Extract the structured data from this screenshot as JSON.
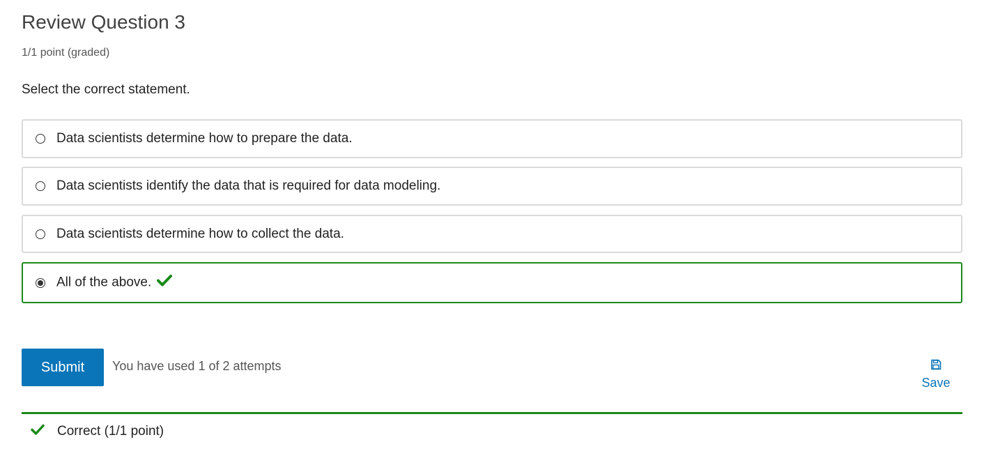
{
  "problem": {
    "title": "Review Question 3",
    "points": "1/1 point (graded)",
    "prompt": "Select the correct statement."
  },
  "choices": [
    {
      "label": "Data scientists determine how to prepare the data.",
      "selected": false,
      "correct": false
    },
    {
      "label": "Data scientists identify the data that is required for data modeling.",
      "selected": false,
      "correct": false
    },
    {
      "label": "Data scientists determine how to collect the data.",
      "selected": false,
      "correct": false
    },
    {
      "label": "All of the above.",
      "selected": true,
      "correct": true
    }
  ],
  "actions": {
    "submit_label": "Submit",
    "attempts_text": "You have used 1 of 2 attempts",
    "save_label": "Save",
    "save_icon": "floppy-disk-icon"
  },
  "feedback": {
    "text": "Correct (1/1 point)",
    "icon": "checkmark-icon"
  },
  "colors": {
    "accent": "#0a75b8",
    "success": "#1a8a1a",
    "border": "#dadada"
  }
}
